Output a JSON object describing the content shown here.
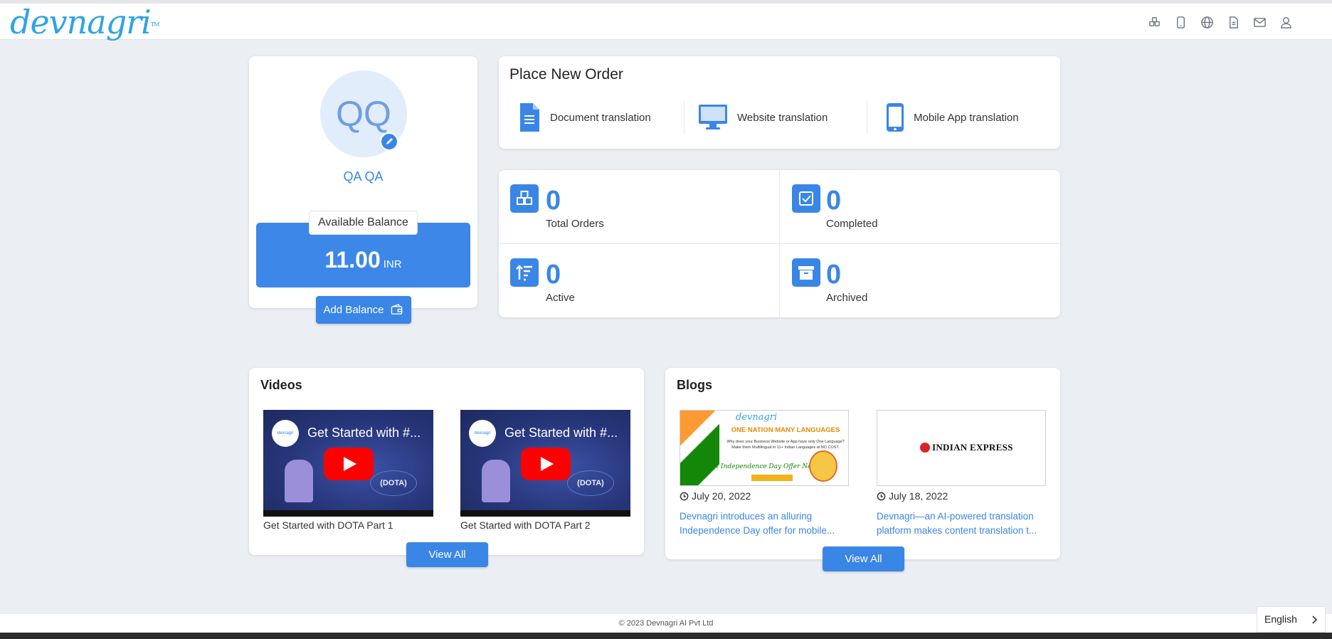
{
  "brand": {
    "logo_text": "devnagri",
    "accent": "#3a86e6"
  },
  "header": {
    "icons": [
      "boxes-icon",
      "mobile-icon",
      "globe-icon",
      "document-icon",
      "mail-icon",
      "user-icon"
    ]
  },
  "profile": {
    "initials": "QQ",
    "name": "QA QA",
    "balance_label": "Available Balance",
    "balance_amount": "11.00",
    "balance_currency": "INR",
    "add_balance_label": "Add Balance"
  },
  "order": {
    "title": "Place New Order",
    "options": [
      {
        "label": "Document translation",
        "icon": "document-icon"
      },
      {
        "label": "Website translation",
        "icon": "monitor-icon"
      },
      {
        "label": "Mobile App translation",
        "icon": "mobile-icon"
      }
    ]
  },
  "stats": [
    {
      "value": "0",
      "label": "Total Orders",
      "icon": "boxes-icon"
    },
    {
      "value": "0",
      "label": "Completed",
      "icon": "checkbox-icon"
    },
    {
      "value": "0",
      "label": "Active",
      "icon": "sort-icon"
    },
    {
      "value": "0",
      "label": "Archived",
      "icon": "archive-icon"
    }
  ],
  "videos": {
    "title": "Videos",
    "items": [
      {
        "thumb_title": "Get Started with #...",
        "caption": "Get Started with DOTA Part 1",
        "thumb_badge": "(DOTA)"
      },
      {
        "thumb_title": "Get Started with #...",
        "caption": "Get Started with DOTA Part 2",
        "thumb_badge": "(DOTA)"
      }
    ],
    "view_all": "View All"
  },
  "blogs": {
    "title": "Blogs",
    "items": [
      {
        "date": "July 20, 2022",
        "title": "Devnagri introduces an alluring Independence Day offer for mobile...",
        "image_brand": "devnagri",
        "image_headline": "ONE NATION MANY LANGUAGES",
        "image_sub": "Why does your Business Website or App have only One Language? Make them Multilingual in 11+ Indian Languages at NO COST.",
        "image_offer": "Get Independence Day Offer Now!"
      },
      {
        "date": "July 18, 2022",
        "title": "Devnagri—an AI-powered translation platform makes content translation t...",
        "image_logo": "INDIAN EXPRESS"
      }
    ],
    "view_all": "View All"
  },
  "footer": {
    "copyright": "© 2023 Devnagri AI Pvt Ltd"
  },
  "language": {
    "selected": "English"
  }
}
